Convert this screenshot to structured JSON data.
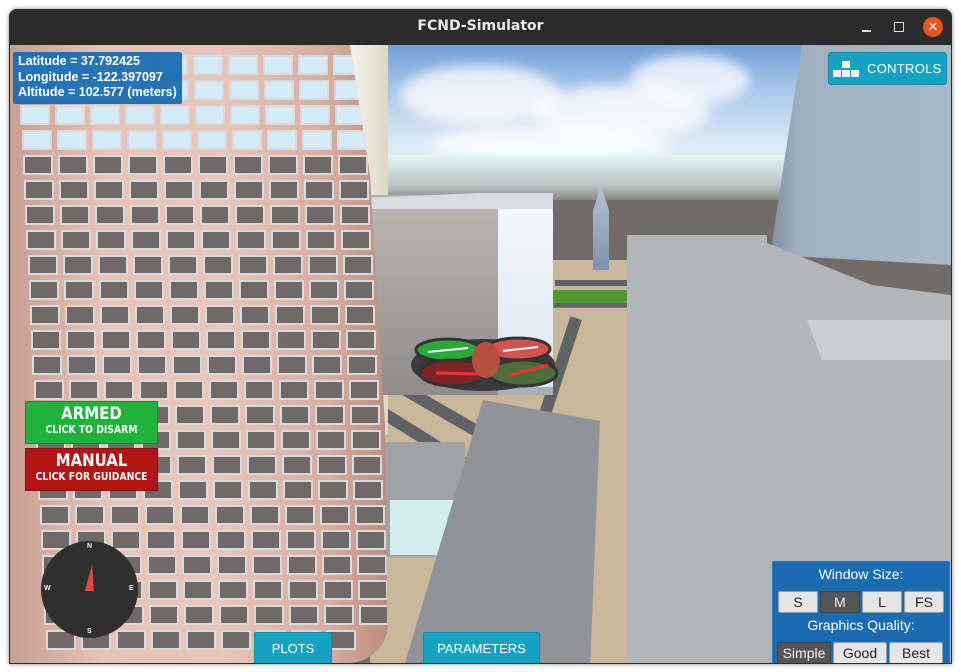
{
  "window": {
    "title": "FCND-Simulator",
    "buttons": {
      "minimize": "minimize",
      "maximize": "maximize",
      "close": "close"
    },
    "close_color": "#e95420"
  },
  "hud": {
    "latitude_label": "Latitude = 37.792425",
    "longitude_label": "Longitude = -122.397097",
    "altitude_label": "Altitude = 102.577 (meters)",
    "latitude": 37.792425,
    "longitude": -122.397097,
    "altitude_m": 102.577
  },
  "controls_button": {
    "label": "CONTROLS",
    "icon": "blocks-icon"
  },
  "armed_button": {
    "title": "ARMED",
    "subtitle": "CLICK TO DISARM",
    "color": "#1fb33b"
  },
  "manual_button": {
    "title": "MANUAL",
    "subtitle": "CLICK FOR GUIDANCE",
    "color": "#b31414"
  },
  "compass": {
    "north": "N",
    "east": "E",
    "south": "S",
    "west": "W",
    "heading_deg": 25
  },
  "bottom_buttons": {
    "plots": "PLOTS",
    "parameters": "PARAMETERS"
  },
  "settings": {
    "window_size_label": "Window Size:",
    "window_sizes": [
      "S",
      "M",
      "L",
      "FS"
    ],
    "window_size_selected": "M",
    "graphics_quality_label": "Graphics Quality:",
    "graphics_qualities": [
      "Simple",
      "Good",
      "Best"
    ],
    "graphics_quality_selected": "Simple"
  },
  "colors": {
    "accent": "#16a2c2",
    "hud_blue": "#1569b0",
    "panel_blue": "#1b6bb0"
  }
}
